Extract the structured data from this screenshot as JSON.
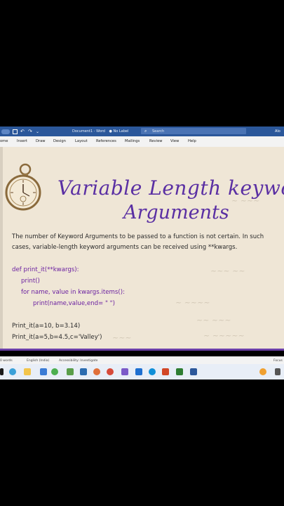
{
  "titlebar": {
    "document_title": "Document1 - Word",
    "label_badge": "No Label",
    "search_placeholder": "Search",
    "user": "Alo"
  },
  "ribbon": {
    "tabs": [
      "ome",
      "Insert",
      "Draw",
      "Design",
      "Layout",
      "References",
      "Mailings",
      "Review",
      "View",
      "Help"
    ]
  },
  "slide": {
    "title_line1": "Variable Length keyword",
    "title_line2": "Arguments",
    "description": "The number of Keyword Arguments to be passed to a function is not certain. In such cases, variable-length keyword arguments can be received using **kwargs.",
    "code_lines": [
      "def print_it(**kwargs):",
      "print()",
      "for name, value in kwargs.items():",
      "print(name,value,end=  \"  \")"
    ],
    "calls": [
      "Print_it(a=10, b=3.14)",
      "Print_it(a=5,b=4.5,c='Valley')"
    ]
  },
  "statusbar": {
    "words": "0 words",
    "language": "English (India)",
    "accessibility": "Accessibility: Investigate",
    "focus": "Focus"
  },
  "colors": {
    "word_blue": "#2b579a",
    "heading_purple": "#5a2fa3",
    "code_purple": "#6a1fa0",
    "parchment": "#efe6d6"
  }
}
